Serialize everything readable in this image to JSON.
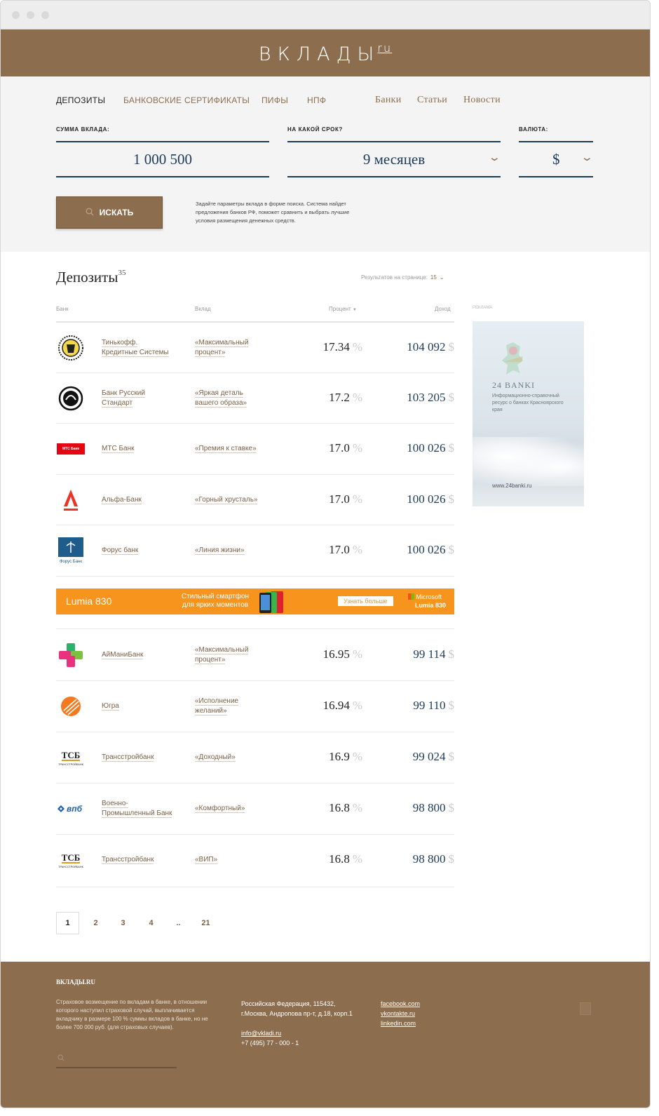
{
  "site": {
    "logo": "ВКЛАДЫ",
    "logo_sup": "ru"
  },
  "nav": {
    "items": [
      "ДЕПОЗИТЫ",
      "БАНКОВСКИЕ СЕРТИФИКАТЫ",
      "ПИФЫ",
      "НПФ"
    ],
    "links": [
      "Банки",
      "Статьи",
      "Новости"
    ]
  },
  "search": {
    "amount_label": "СУММА ВКЛАДА:",
    "amount_value": "1 000 500",
    "term_label": "НА КАКОЙ СРОК?",
    "term_value": "9 месяцев",
    "currency_label": "ВАЛЮТА:",
    "currency_value": "$",
    "button": "ИСКАТЬ",
    "help": "Задайте параметры вклада в форме поиска. Система найдет предложения банков РФ, поможет сравнить и выбрать лучшие условия размещения денежных средств."
  },
  "results": {
    "title": "Депозиты",
    "count": "35",
    "per_page_label": "Результатов на странице:",
    "per_page_value": "15",
    "col_bank": "Банк",
    "col_deposit": "Вклад",
    "col_percent": "Процент",
    "col_income": "Доход",
    "ad_label": "РЕКЛАМА"
  },
  "rows": [
    {
      "bank": [
        "Тинькофф.",
        "Кредитные Системы"
      ],
      "deposit": [
        "«Максимальный",
        "процент»"
      ],
      "percent": "17.34",
      "income": "104 092",
      "logo": "tinkoff-logo-icon"
    },
    {
      "bank": [
        "Банк Русский",
        "Стандарт"
      ],
      "deposit": [
        "«Яркая деталь",
        "вашего образа»"
      ],
      "percent": "17.2",
      "income": "103 205",
      "logo": "russian-standard-logo-icon"
    },
    {
      "bank": [
        "МТС Банк"
      ],
      "deposit": [
        "«Премия к ставке»"
      ],
      "percent": "17.0",
      "income": "100 026",
      "logo": "mts-logo-icon"
    },
    {
      "bank": [
        "Альфа-Банк"
      ],
      "deposit": [
        "«Горный хрусталь»"
      ],
      "percent": "17.0",
      "income": "100 026",
      "logo": "alfa-logo-icon"
    },
    {
      "bank": [
        "Форус банк"
      ],
      "deposit": [
        "«Линия жизни»"
      ],
      "percent": "17.0",
      "income": "100 026",
      "logo": "forus-logo-icon"
    },
    {
      "bank": [
        "АйМаниБанк"
      ],
      "deposit": [
        "«Максимальный",
        "процент»"
      ],
      "percent": "16.95",
      "income": "99 114",
      "logo": "imoney-logo-icon"
    },
    {
      "bank": [
        "Югра"
      ],
      "deposit": [
        "«Исполнение",
        "желаний»"
      ],
      "percent": "16.94",
      "income": "99 110",
      "logo": "yugra-logo-icon"
    },
    {
      "bank": [
        "Трансстройбанк"
      ],
      "deposit": [
        "«Доходный»"
      ],
      "percent": "16.9",
      "income": "99 024",
      "logo": "tsb-logo-icon"
    },
    {
      "bank": [
        "Военно-",
        "Промышленный Банк"
      ],
      "deposit": [
        "«Комфортный»"
      ],
      "percent": "16.8",
      "income": "98 800",
      "logo": "vpb-logo-icon"
    },
    {
      "bank": [
        "Трансстройбанк"
      ],
      "deposit": [
        "«ВИП»"
      ],
      "percent": "16.8",
      "income": "98 800",
      "logo": "tsb-logo-icon"
    }
  ],
  "currency_symbol": "$",
  "percent_symbol": "%",
  "mts_text": "МТС Банк",
  "tsb_text": "ТСБ",
  "tsb_sub": "ТРАНССТРОЙБАНК",
  "vpb_text": "впб",
  "forus_text": "Форус Банк",
  "banner": {
    "title": "Lumia 830",
    "tagline1": "Стильный смартфон",
    "tagline2": "для ярких моментов",
    "cta": "Узнать больше",
    "brand": "Microsoft",
    "brand_sub": "Lumia 830"
  },
  "ad": {
    "title": "24 BANKI",
    "desc": "Информационно-справочный ресурс о банках Красноярского края",
    "url": "www.24banki.ru"
  },
  "pagination": [
    "1",
    "2",
    "3",
    "4",
    "..",
    "21"
  ],
  "footer": {
    "brand": "ВКЛАДЫ.RU",
    "about": "Страховое возмещение по вкладам в банке, в отношении которого наступил страховой случай, выплачивается вкладчику в размере 100 % суммы вкладов в банке, но не более 700 000 руб. (для страховых случаев).",
    "address1": "Российская Федерация, 115432,",
    "address2": "г.Москва, Андропова пр-т, д.18, корп.1",
    "email": "info@vkladi.ru",
    "phone": "+7 (495) 77 - 000 - 1",
    "social": [
      "facebook.com",
      "vkontakte.ru",
      "linkedin.com"
    ]
  }
}
